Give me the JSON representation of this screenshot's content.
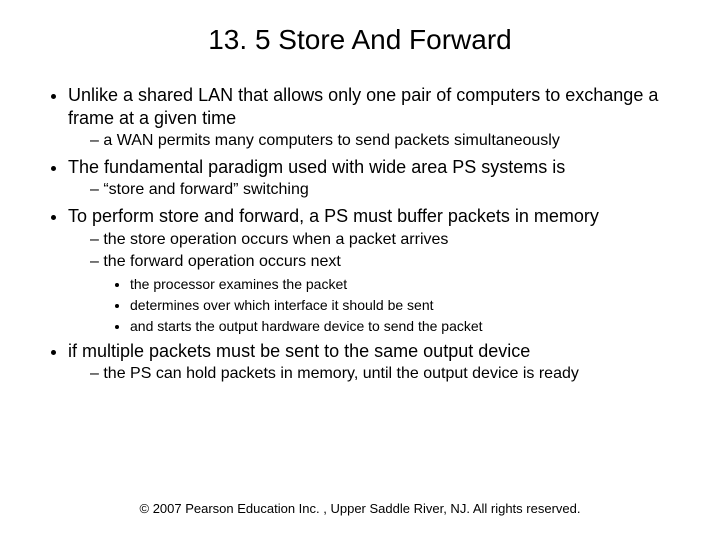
{
  "title": "13. 5 Store And Forward",
  "bullets": {
    "b1": "Unlike a shared LAN that allows only one pair of computers to exchange a frame at a given time",
    "b1_1": "a WAN permits many computers to send packets simultaneously",
    "b2": "The fundamental paradigm used with wide area PS systems is",
    "b2_1": "“store and forward” switching",
    "b3": "To perform store and forward, a PS must buffer packets in memory",
    "b3_1": "the store operation occurs when a packet arrives",
    "b3_2": "the  forward operation occurs next",
    "b3_2_1": "the processor examines the packet",
    "b3_2_2": "determines over which interface it should be sent",
    "b3_2_3": "and starts the output hardware device to send the packet",
    "b4": "if multiple packets must be sent to the same output device",
    "b4_1": "the PS can hold packets in memory, until the output device is ready"
  },
  "footer": "© 2007 Pearson Education Inc. , Upper Saddle River, NJ. All rights reserved."
}
